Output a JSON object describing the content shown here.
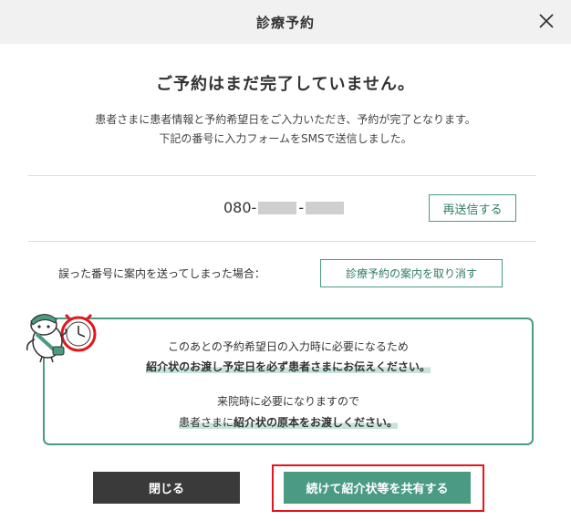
{
  "dialog": {
    "title": "診療予約",
    "close_icon": "close-icon"
  },
  "main": {
    "heading": "ご予約はまだ完了していません。",
    "description_line1": "患者さまに患者情報と予約希望日をご入力いただき、予約が完了となります。",
    "description_line2": "下記の番号に入力フォームをSMSで送信しました。"
  },
  "phone": {
    "prefix": "080-",
    "separator": "-",
    "resend_label": "再送信する"
  },
  "cancel": {
    "label": "誤った番号に案内を送ってしまった場合：",
    "button_label": "診療予約の案内を取り消す"
  },
  "notice": {
    "line1": "このあとの予約希望日の入力時に必要になるため",
    "line2": "紹介状のお渡し予定日を必ず患者さまにお伝えください。",
    "line3": "来院時に必要になりますので",
    "line4_plain": "患者さまに",
    "line4_bold": "紹介状の原本をお渡しください。",
    "mascot_icon": "doctor-mascot-with-clock-icon"
  },
  "footer": {
    "close_label": "閉じる",
    "share_label": "続けて紹介状等を共有する"
  },
  "colors": {
    "accent": "#4a9b82",
    "dark_button": "#3a3a3a",
    "highlight_frame": "#e4151c",
    "header_bg": "#f1f1f1"
  }
}
